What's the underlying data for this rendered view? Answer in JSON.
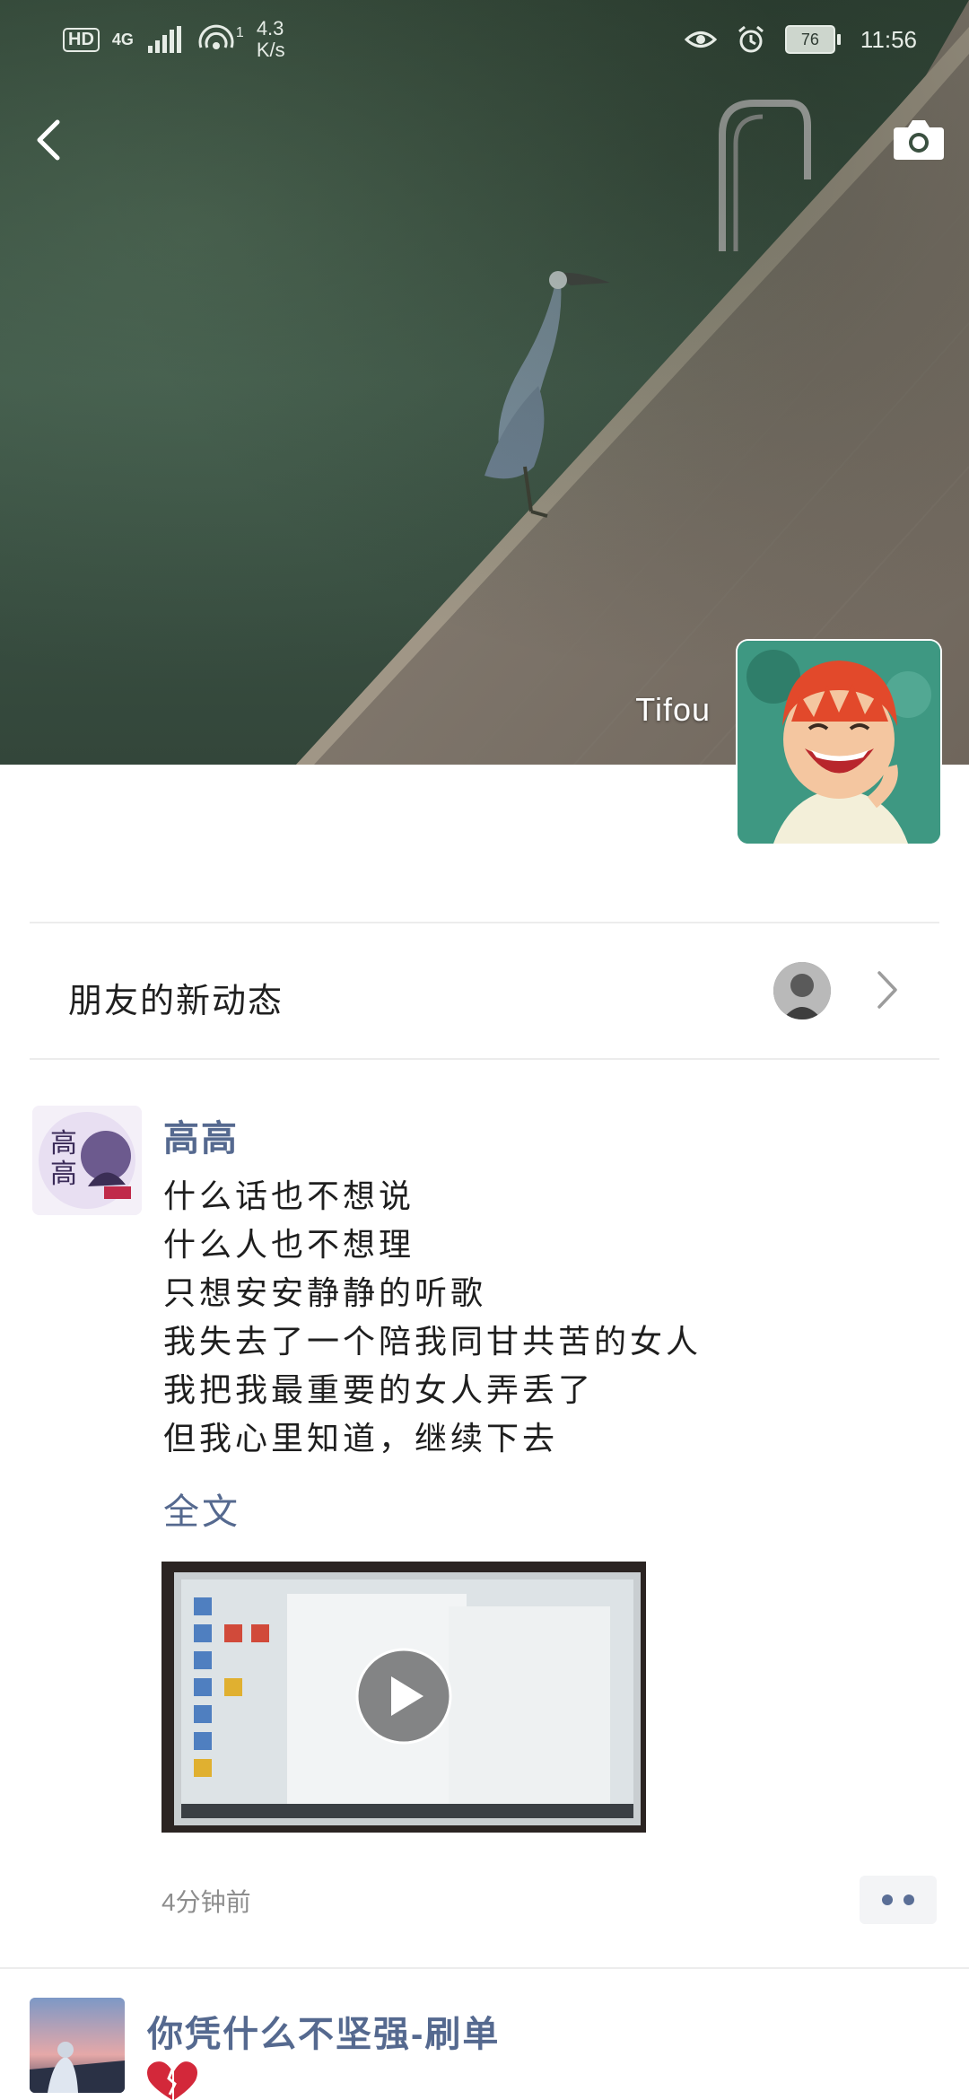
{
  "status_bar": {
    "hd": "HD",
    "network": "4G",
    "hotspot_count": "1",
    "speed_value": "4.3",
    "speed_unit": "K/s",
    "battery": "76",
    "time": "11:56"
  },
  "cover": {
    "user_name": "Tifou"
  },
  "friends_row": {
    "label": "朋友的新动态"
  },
  "post": {
    "author": "高高",
    "lines": [
      "什么话也不想说",
      "什么人也不想理",
      "只想安安静静的听歌",
      "我失去了一个陪我同甘共苦的女人",
      "我把我最重要的女人弄丢了",
      "但我心里知道，继续下去"
    ],
    "full_text_link": "全文",
    "time": "4分钟前"
  },
  "next_post": {
    "author": "你凭什么不坚强-刷单"
  },
  "colors": {
    "link_blue": "#55698f",
    "text": "#1e1e1e",
    "muted": "#8d8d8d"
  }
}
